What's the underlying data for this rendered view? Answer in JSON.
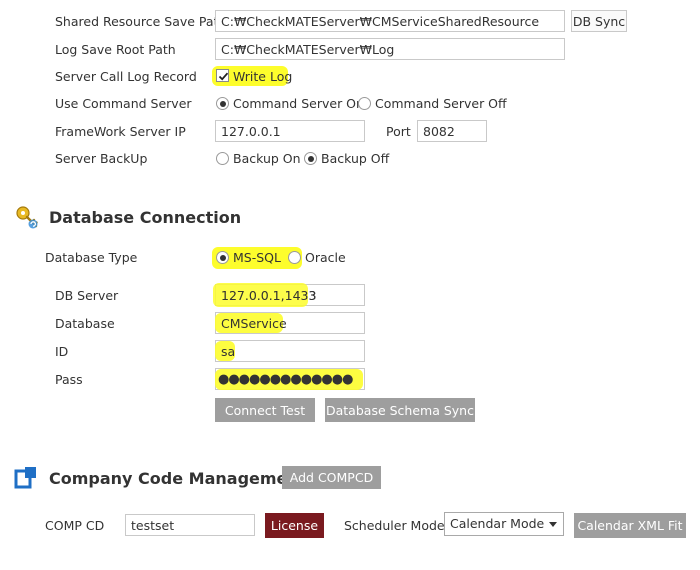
{
  "server": {
    "shared_path_label": "Shared Resource Save Path",
    "shared_path_value": "C:₩CheckMATEServer₩CMServiceSharedResource",
    "db_sync_label": "DB Sync",
    "log_path_label": "Log Save Root Path",
    "log_path_value": "C:₩CheckMATEServer₩Log",
    "call_log_label": "Server Call Log Record",
    "write_log_label": "Write Log",
    "write_log_checked": true,
    "command_server_label": "Use Command Server",
    "command_on_label": "Command Server On",
    "command_off_label": "Command Server Off",
    "command_selected": "on",
    "framework_ip_label": "FrameWork Server IP",
    "framework_ip_value": "127.0.0.1",
    "port_label": "Port",
    "port_value": "8082",
    "backup_label": "Server BackUp",
    "backup_on_label": "Backup On",
    "backup_off_label": "Backup Off",
    "backup_selected": "off"
  },
  "database": {
    "title": "Database Connection",
    "type_label": "Database Type",
    "mssql_label": "MS-SQL",
    "oracle_label": "Oracle",
    "type_selected": "mssql",
    "server_label": "DB Server",
    "server_value": "127.0.0.1,1433",
    "db_label": "Database",
    "db_value": "CMService",
    "id_label": "ID",
    "id_value": "sa",
    "pass_label": "Pass",
    "pass_value": "●●●●●●●●●●●●●",
    "connect_test_label": "Connect Test",
    "schema_sync_label": "Database Schema Sync"
  },
  "company": {
    "title": "Company Code Management",
    "add_label": "Add COMPCD",
    "comp_cd_label": "COMP CD",
    "comp_cd_value": "testset",
    "license_label": "License",
    "scheduler_label": "Scheduler Mode",
    "scheduler_value": "Calendar Mode",
    "calendar_fit_label": "Calendar XML Fit"
  },
  "colors": {
    "highlight": "#fdfd2c",
    "button_gray": "#9e9e9e",
    "license_red": "#7a1a1f",
    "db_icon_gold": "#d4a017",
    "company_icon_blue": "#1f6fc5"
  }
}
